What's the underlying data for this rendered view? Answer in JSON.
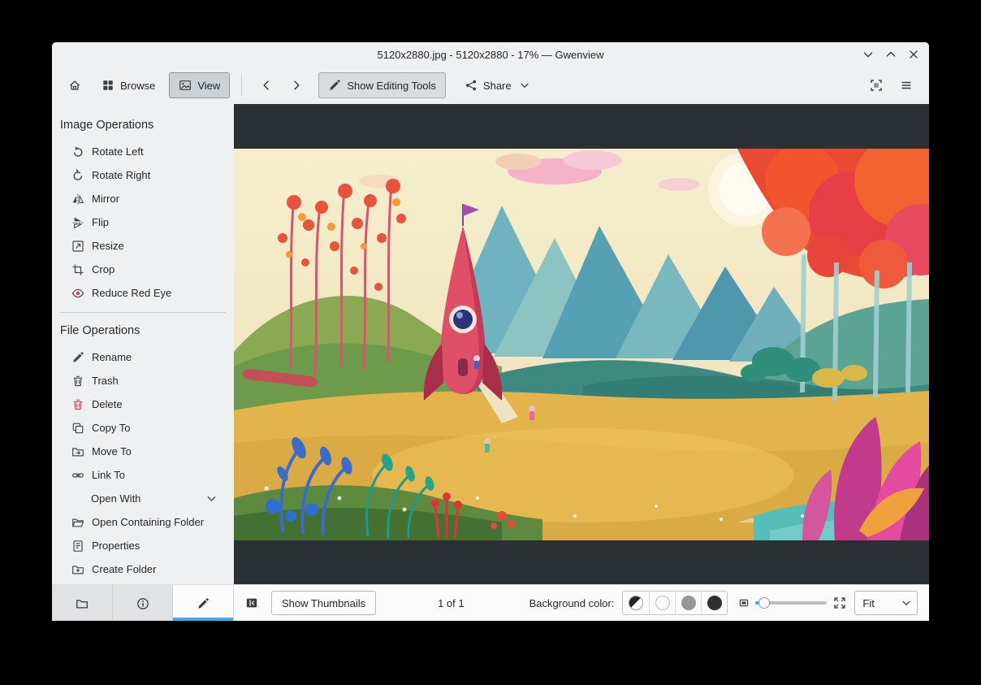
{
  "window": {
    "title": "5120x2880.jpg - 5120x2880 - 17% — Gwenview",
    "controls": [
      {
        "name": "minimize",
        "icon": "chevron-down"
      },
      {
        "name": "maximize",
        "icon": "chevron-up"
      },
      {
        "name": "close",
        "icon": "close"
      }
    ]
  },
  "toolbar": {
    "home": {
      "icon": "home"
    },
    "browse": {
      "label": "Browse",
      "icon": "grid"
    },
    "view": {
      "label": "View",
      "icon": "image",
      "active": true
    },
    "back": {
      "icon": "chevron-left"
    },
    "forward": {
      "icon": "chevron-right"
    },
    "show_editing_tools": {
      "label": "Show Editing Tools",
      "icon": "pencil",
      "active": true
    },
    "share": {
      "label": "Share",
      "icon": "share",
      "has_dropdown": true
    },
    "fit_view": {
      "icon": "fit-frame"
    },
    "menu": {
      "icon": "hamburger"
    }
  },
  "sidebar": {
    "image_operations": {
      "title": "Image Operations",
      "items": [
        {
          "label": "Rotate Left",
          "icon": "rotate-left"
        },
        {
          "label": "Rotate Right",
          "icon": "rotate-right"
        },
        {
          "label": "Mirror",
          "icon": "mirror"
        },
        {
          "label": "Flip",
          "icon": "flip"
        },
        {
          "label": "Resize",
          "icon": "resize"
        },
        {
          "label": "Crop",
          "icon": "crop"
        },
        {
          "label": "Reduce Red Eye",
          "icon": "red-eye"
        }
      ]
    },
    "file_operations": {
      "title": "File Operations",
      "items": [
        {
          "label": "Rename",
          "icon": "rename"
        },
        {
          "label": "Trash",
          "icon": "trash"
        },
        {
          "label": "Delete",
          "icon": "delete"
        },
        {
          "label": "Copy To",
          "icon": "copy"
        },
        {
          "label": "Move To",
          "icon": "move"
        },
        {
          "label": "Link To",
          "icon": "link"
        },
        {
          "label": "Open With",
          "icon": "",
          "has_submenu": true
        },
        {
          "label": "Open Containing Folder",
          "icon": "folder-open"
        },
        {
          "label": "Properties",
          "icon": "properties"
        },
        {
          "label": "Create Folder",
          "icon": "folder-new"
        }
      ]
    },
    "tabs": [
      {
        "name": "folders",
        "icon": "folder",
        "active": false
      },
      {
        "name": "information",
        "icon": "info",
        "active": false
      },
      {
        "name": "operations",
        "icon": "pencil",
        "active": true
      }
    ]
  },
  "statusbar": {
    "show_thumbnails": "Show Thumbnails",
    "page_indicator": "1 of 1",
    "background_color_label": "Background color:",
    "background_colors": [
      {
        "name": "auto",
        "colors": [
          "#232629",
          "#fcfcfc"
        ],
        "selected": false
      },
      {
        "name": "light",
        "color": "#fcfcfc",
        "selected": false
      },
      {
        "name": "gray",
        "color": "#95989a",
        "selected": false
      },
      {
        "name": "dark",
        "color": "#2e3134",
        "selected": true
      }
    ],
    "zoom_mode": "Fit"
  },
  "colors": {
    "accent": "#3daee9",
    "window_background": "#eff0f1",
    "canvas_background": "#2b3035",
    "danger_icon": "#da4453"
  }
}
